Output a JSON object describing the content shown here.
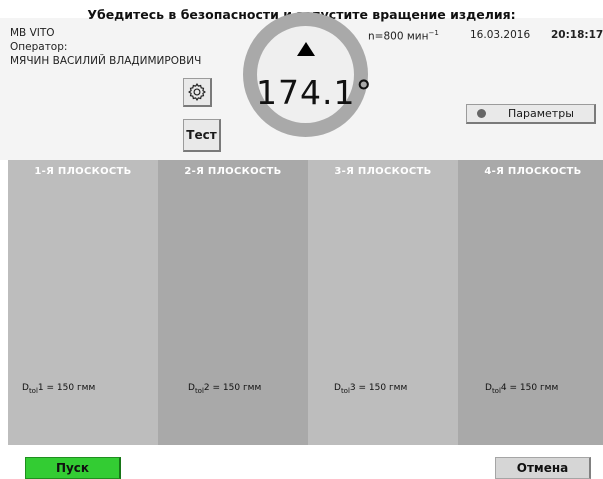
{
  "header": {
    "instruction": "Убедитесь в безопасности и запустите вращение изделия:"
  },
  "info": {
    "machine": "MB VITO",
    "operator_label": "Оператор:",
    "operator_name": "МЯЧИН ВАСИЛИЙ ВЛАДИМИРОВИЧ",
    "speed_prefix": "n=800 мин",
    "speed_exp": "−1",
    "date": "16.03.2016",
    "time": "20:18:17"
  },
  "dial": {
    "angle": "174.1°"
  },
  "buttons": {
    "settings_icon": "gear-icon",
    "test": "Тест",
    "params": "Параметры",
    "start": "Пуск",
    "cancel": "Отмена"
  },
  "planes": [
    {
      "title": "1-Я ПЛОСКОСТЬ",
      "tol_prefix": "D",
      "tol_sub": "tol",
      "tol_value": "1 = 150 гмм",
      "color": "#bdbdbd"
    },
    {
      "title": "2-Я ПЛОСКОСТЬ",
      "tol_prefix": "D",
      "tol_sub": "tol",
      "tol_value": "2 = 150 гмм",
      "color": "#a9a9a9"
    },
    {
      "title": "3-Я ПЛОСКОСТЬ",
      "tol_prefix": "D",
      "tol_sub": "tol",
      "tol_value": "3 = 150 гмм",
      "color": "#bdbdbd"
    },
    {
      "title": "4-Я ПЛОСКОСТЬ",
      "tol_prefix": "D",
      "tol_sub": "tol",
      "tol_value": "4 = 150 гмм",
      "color": "#a9a9a9"
    }
  ],
  "colors": {
    "start": "#33cc33",
    "panel": "#f4f4f4",
    "dial_ring": "#a9a9a9"
  }
}
